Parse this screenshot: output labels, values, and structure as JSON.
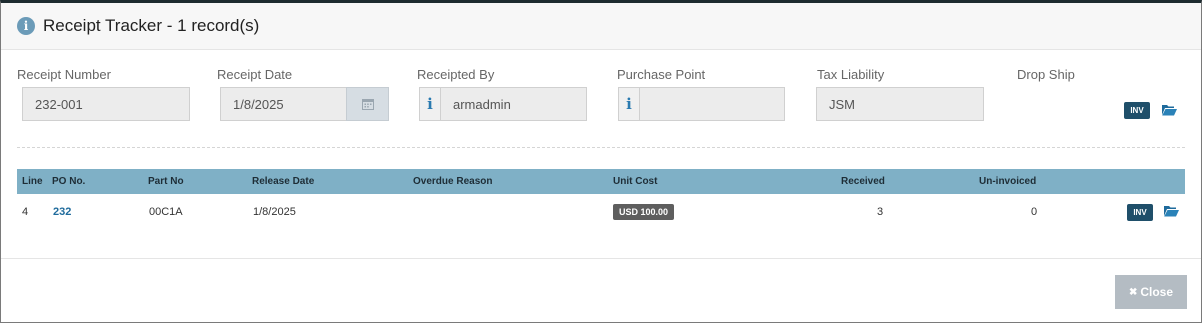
{
  "header": {
    "title": "Receipt Tracker - 1 record(s)"
  },
  "fields": {
    "receipt_number": {
      "label": "Receipt Number",
      "value": "232-001"
    },
    "receipt_date": {
      "label": "Receipt Date",
      "value": "1/8/2025"
    },
    "receipted_by": {
      "label": "Receipted By",
      "value": "armadmin"
    },
    "purchase_point": {
      "label": "Purchase Point",
      "value": ""
    },
    "tax_liability": {
      "label": "Tax Liability",
      "value": "JSM"
    },
    "drop_ship": {
      "label": "Drop Ship"
    }
  },
  "inv_label": "INV",
  "info_glyph": "i",
  "table": {
    "columns": [
      "Line",
      "PO No.",
      "Part No",
      "Release Date",
      "Overdue Reason",
      "Unit Cost",
      "Received",
      "Un-invoiced"
    ],
    "rows": [
      {
        "line": "4",
        "po": "232",
        "part": "00C1A",
        "release_date": "1/8/2025",
        "overdue_reason": "",
        "unit_cost": "USD 100.00",
        "received": "3",
        "uninvoiced": "0"
      }
    ]
  },
  "footer": {
    "close_label": "Close",
    "close_icon": "✖"
  },
  "colors": {
    "header_row": "#7fb0c6",
    "inv_badge": "#1f4f6a",
    "link": "#1f6b9c",
    "close_button": "#b4bcc3"
  }
}
